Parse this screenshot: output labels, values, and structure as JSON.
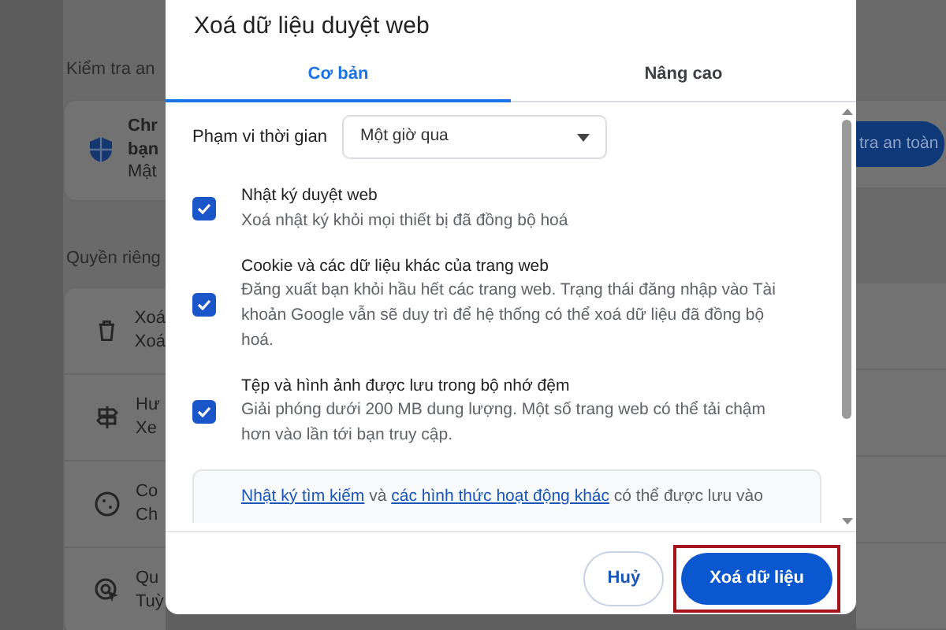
{
  "background": {
    "safety_heading": "Kiểm tra an",
    "safety_card": {
      "lines": [
        "Chr",
        "bạn"
      ],
      "subtitle": "Mật",
      "button": "tra an toàn"
    },
    "privacy_heading": "Quyền riêng",
    "privacy_rows": [
      {
        "kind": "trash",
        "title": "Xoá",
        "subtitle": "Xoá"
      },
      {
        "kind": "signpost",
        "title": "Hư",
        "subtitle": "Xe"
      },
      {
        "kind": "cookie",
        "title": "Co",
        "subtitle": "Ch"
      },
      {
        "kind": "target",
        "title": "Qu",
        "subtitle": "Tuỳ"
      }
    ]
  },
  "dialog": {
    "title": "Xoá dữ liệu duyệt web",
    "tabs": [
      {
        "label": "Cơ bản",
        "selected": true
      },
      {
        "label": "Nâng cao",
        "selected": false
      }
    ],
    "time_range": {
      "label": "Phạm vi thời gian",
      "value": "Một giờ qua"
    },
    "options": [
      {
        "title": "Nhật ký duyệt web",
        "description": "Xoá nhật ký khỏi mọi thiết bị đã đồng bộ hoá",
        "checked": true
      },
      {
        "title": "Cookie và các dữ liệu khác của trang web",
        "description": "Đăng xuất bạn khỏi hầu hết các trang web. Trạng thái đăng nhập vào Tài khoản Google vẫn sẽ duy trì để hệ thống có thể xoá dữ liệu đã đồng bộ hoá.",
        "checked": true
      },
      {
        "title": "Tệp và hình ảnh được lưu trong bộ nhớ đệm",
        "description": "Giải phóng dưới 200 MB dung lượng. Một số trang web có thể tải chậm hơn vào lần tới bạn truy cập.",
        "checked": true
      }
    ],
    "notice": [
      {
        "kind": "link",
        "text": "Nhật ký tìm kiếm"
      },
      {
        "kind": "text",
        "text": " và "
      },
      {
        "kind": "link",
        "text": "các hình thức hoạt động khác"
      },
      {
        "kind": "text",
        "text": " có thể được lưu vào"
      }
    ],
    "buttons": [
      {
        "label": "Huỷ",
        "kind": "secondary",
        "highlighted": false
      },
      {
        "label": "Xoá dữ liệu",
        "kind": "primary",
        "highlighted": true
      }
    ]
  }
}
